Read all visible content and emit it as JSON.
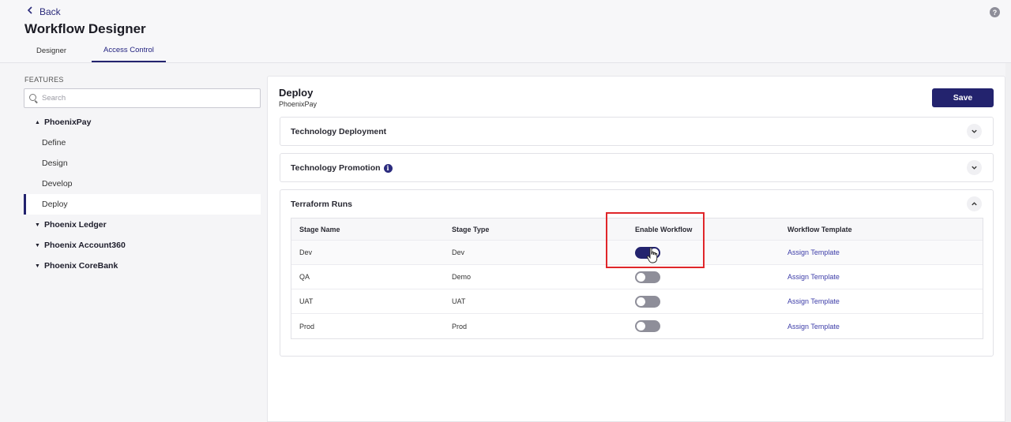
{
  "header": {
    "back_label": "Back",
    "title": "Workflow Designer",
    "help_icon": "?",
    "tabs": [
      {
        "label": "Designer",
        "active": false
      },
      {
        "label": "Access Control",
        "active": true
      }
    ]
  },
  "sidebar": {
    "section_label": "FEATURES",
    "search_placeholder": "Search",
    "tree": {
      "groups": [
        {
          "label": "PhoenixPay",
          "expanded": true,
          "children": [
            "Define",
            "Design",
            "Develop",
            "Deploy"
          ],
          "selected_child": "Deploy"
        },
        {
          "label": "Phoenix Ledger",
          "expanded": false
        },
        {
          "label": "Phoenix Account360",
          "expanded": false
        },
        {
          "label": "Phoenix CoreBank",
          "expanded": false
        }
      ]
    }
  },
  "main": {
    "title": "Deploy",
    "subtitle": "PhoenixPay",
    "save_label": "Save",
    "panels": [
      {
        "title": "Technology Deployment",
        "expanded": false,
        "has_info": false
      },
      {
        "title": "Technology Promotion",
        "expanded": false,
        "has_info": true,
        "info_glyph": "i"
      },
      {
        "title": "Terraform Runs",
        "expanded": true,
        "has_info": false
      }
    ],
    "table": {
      "headers": [
        "Stage Name",
        "Stage Type",
        "Enable Workflow",
        "Workflow Template"
      ],
      "rows": [
        {
          "stage_name": "Dev",
          "stage_type": "Dev",
          "enabled": true,
          "template": "Assign Template"
        },
        {
          "stage_name": "QA",
          "stage_type": "Demo",
          "enabled": false,
          "template": "Assign Template"
        },
        {
          "stage_name": "UAT",
          "stage_type": "UAT",
          "enabled": false,
          "template": "Assign Template"
        },
        {
          "stage_name": "Prod",
          "stage_type": "Prod",
          "enabled": false,
          "template": "Assign Template"
        }
      ]
    }
  },
  "colors": {
    "primary": "#23236e",
    "link": "#3d3da8",
    "highlight": "#e0262a",
    "toggle_off": "#8e8e99"
  }
}
